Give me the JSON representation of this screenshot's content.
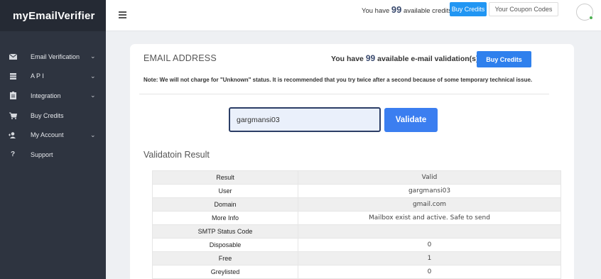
{
  "brand": {
    "name": "myEmailVerifier"
  },
  "sidebar": {
    "items": [
      {
        "label": "Email Verification",
        "icon": "envelope-icon",
        "has_submenu": true
      },
      {
        "label": "A P I",
        "icon": "server-icon",
        "has_submenu": true
      },
      {
        "label": "Integration",
        "icon": "clipboard-icon",
        "has_submenu": true
      },
      {
        "label": "Buy Credits",
        "icon": "cart-icon",
        "has_submenu": false
      },
      {
        "label": "My Account",
        "icon": "user-add-icon",
        "has_submenu": true
      },
      {
        "label": "Support",
        "icon": "question-icon",
        "has_submenu": false
      }
    ]
  },
  "topbar": {
    "credits_prefix": "You have",
    "credits_count": "99",
    "credits_suffix": "available credits.",
    "buy_credits_label": "Buy Credits",
    "coupon_codes_label": "Your Coupon Codes"
  },
  "card": {
    "title": "EMAIL ADDRESS",
    "credits_prefix": "You have",
    "credits_count": "99",
    "credits_suffix": "available e-mail validation(s).",
    "buy_credits_label": "Buy Credits",
    "note": "Note: We will not charge for \"Unknown\" status. It is recommended that you try twice after a second because of some temporary technical issue.",
    "email_value": "gargmansi03",
    "validate_label": "Validate",
    "result_title": "Validatoin Result"
  },
  "results": [
    {
      "key": "Result",
      "value": "Valid"
    },
    {
      "key": "User",
      "value": "gargmansi03"
    },
    {
      "key": "Domain",
      "value": "gmail.com"
    },
    {
      "key": "More Info",
      "value": "Mailbox exist and active. Safe to send"
    },
    {
      "key": "SMTP Status Code",
      "value": ""
    },
    {
      "key": "Disposable",
      "value": "0"
    },
    {
      "key": "Free",
      "value": "1"
    },
    {
      "key": "Greylisted",
      "value": "0"
    }
  ],
  "colors": {
    "sidebar_bg": "#2e3440",
    "accent": "#2f80ed",
    "valid": "#2e7d32",
    "link": "#2f7fd1"
  }
}
